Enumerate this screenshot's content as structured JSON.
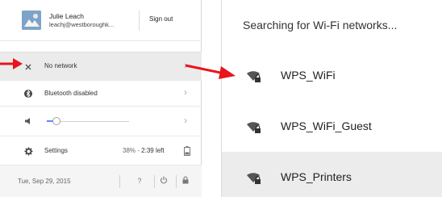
{
  "tray": {
    "user": {
      "name": "Julie Leach",
      "email": "leachj@westboroughk...",
      "avatar_icon": "avatar-icon"
    },
    "sign_out_label": "Sign out",
    "network": {
      "label": "No network",
      "icon": "network-off-icon"
    },
    "bluetooth": {
      "label": "Bluetooth disabled",
      "icon": "bluetooth-icon"
    },
    "volume": {
      "icon": "speaker-icon",
      "level": 0.12
    },
    "settings": {
      "label": "Settings",
      "icon": "gear-icon",
      "battery_percent": "38%",
      "battery_separator": "-",
      "battery_time": "2:39 left",
      "battery_icon": "battery-icon"
    },
    "footer": {
      "date": "Tue, Sep 29, 2015",
      "help_label": "?",
      "power_icon": "power-icon",
      "lock_icon": "lock-icon"
    }
  },
  "wifi": {
    "status": "Searching for Wi-Fi networks...",
    "networks": [
      {
        "name": "WPS_WiFi",
        "icon": "wifi-secured-icon"
      },
      {
        "name": "WPS_WiFi_Guest",
        "icon": "wifi-secured-icon"
      },
      {
        "name": "WPS_Printers",
        "icon": "wifi-secured-icon"
      }
    ]
  },
  "colors": {
    "arrow": "#e8141c",
    "accent": "#4d90fe",
    "highlight_row": "#ebebeb"
  }
}
